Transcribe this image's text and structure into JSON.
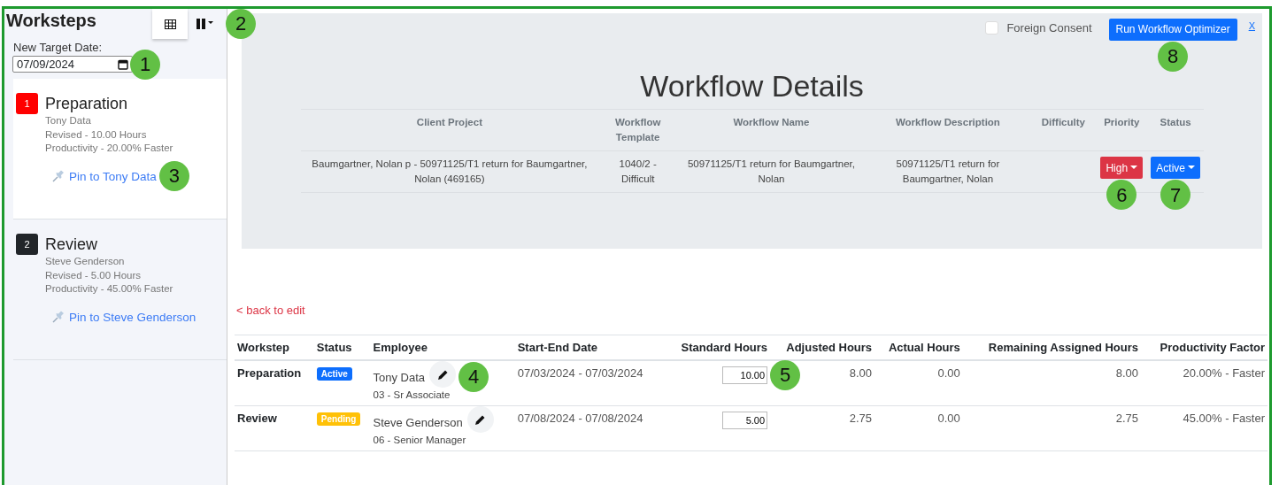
{
  "sidebar": {
    "title": "Worksteps",
    "view_buttons": [
      {
        "kind": "grid",
        "selected": true
      },
      {
        "kind": "columns",
        "selected": false
      }
    ],
    "target_date": {
      "label": "New Target Date:",
      "value": "07/09/2024"
    },
    "steps": [
      {
        "number": "1",
        "color": "#ff0000",
        "selected": true,
        "title": "Preparation",
        "employee": "Tony Data",
        "revised": "Revised - 10.00 Hours",
        "productivity": "Productivity - 20.00% Faster",
        "pin_link": "Pin to Tony Data"
      },
      {
        "number": "2",
        "color": "#212529",
        "selected": false,
        "title": "Review",
        "employee": "Steve Genderson",
        "revised": "Revised - 5.00 Hours",
        "productivity": "Productivity - 45.00% Faster",
        "pin_link": "Pin to Steve Genderson"
      }
    ]
  },
  "details": {
    "foreign_consent": {
      "label": "Foreign Consent",
      "checked": false
    },
    "optimizer_button": "Run Workflow Optimizer",
    "close_link": "X",
    "title": "Workflow Details",
    "columns": [
      "Client Project",
      "Workflow Template",
      "Workflow Name",
      "Workflow Description",
      "Difficulty",
      "Priority",
      "Status"
    ],
    "row": {
      "client_project": "Baumgartner, Nolan p - 50971125/T1 return for Baumgartner, Nolan (469165)",
      "template": "1040/2 - Difficult",
      "name": "50971125/T1 return for Baumgartner, Nolan",
      "description": "50971125/T1 return for Baumgartner, Nolan",
      "priority": {
        "label": "High",
        "color": "#dc3545"
      },
      "status": {
        "label": "Active",
        "color": "#0d6efd"
      }
    }
  },
  "back_link": "< back to edit",
  "worksteps_table": {
    "columns": [
      "Workstep",
      "Status",
      "Employee",
      "Start-End Date",
      "Standard Hours",
      "Adjusted Hours",
      "Actual Hours",
      "Remaining Assigned Hours",
      "Productivity Factor"
    ],
    "rows": [
      {
        "workstep": "Preparation",
        "status": {
          "label": "Active",
          "color": "#0d6efd"
        },
        "employee": "Tony Data",
        "role": "03 - Sr Associate",
        "dates": "07/03/2024 - 07/03/2024",
        "standard_hours": "10.00",
        "adjusted_hours": "8.00",
        "actual_hours": "0.00",
        "remaining_hours": "8.00",
        "productivity": "20.00% - Faster"
      },
      {
        "workstep": "Review",
        "status": {
          "label": "Pending",
          "color": "#ffc107"
        },
        "employee": "Steve Genderson",
        "role": "06 - Senior Manager",
        "dates": "07/08/2024 - 07/08/2024",
        "standard_hours": "5.00",
        "adjusted_hours": "2.75",
        "actual_hours": "0.00",
        "remaining_hours": "2.75",
        "productivity": "45.00% - Faster"
      }
    ]
  },
  "callouts": [
    "1",
    "2",
    "3",
    "4",
    "5",
    "6",
    "7",
    "8"
  ]
}
